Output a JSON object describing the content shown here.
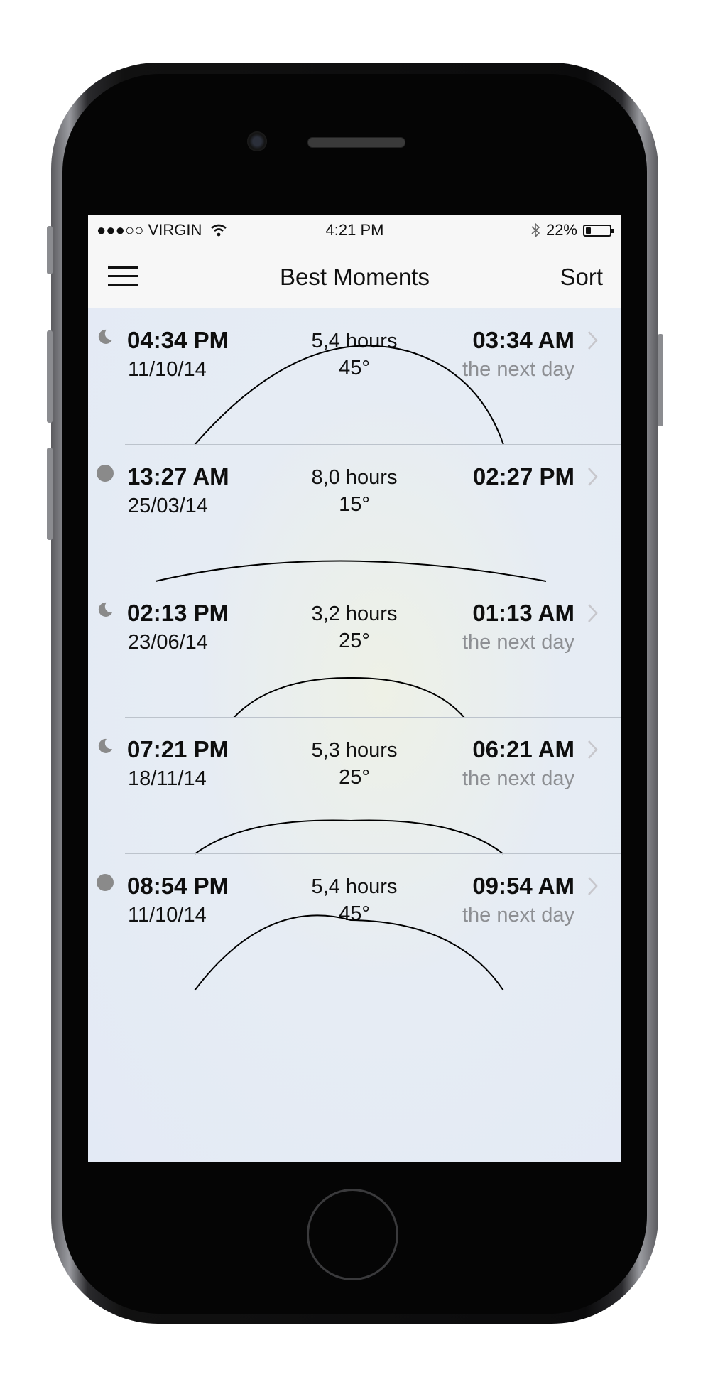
{
  "status_bar": {
    "carrier": "●●●○○ VIRGIN",
    "time": "4:21 PM",
    "battery_text": "22%",
    "battery_level": 0.22
  },
  "nav": {
    "title": "Best Moments",
    "sort_label": "Sort"
  },
  "colors": {
    "text": "#0e0e0e",
    "secondary_text": "#8d8f93",
    "indicator": "#8a8a8a",
    "divider": "#bcc3cc"
  },
  "moments": [
    {
      "icon": "moon-icon",
      "start_time": "04:34 PM",
      "date": "11/10/14",
      "duration": "5,4 hours",
      "angle": "45°",
      "end_time": "03:34 AM",
      "end_note": "the next day"
    },
    {
      "icon": "full-moon-icon",
      "start_time": "13:27 AM",
      "date": "25/03/14",
      "duration": "8,0 hours",
      "angle": "15°",
      "end_time": "02:27 PM",
      "end_note": ""
    },
    {
      "icon": "moon-icon",
      "start_time": "02:13 PM",
      "date": "23/06/14",
      "duration": "3,2 hours",
      "angle": "25°",
      "end_time": "01:13 AM",
      "end_note": "the next day"
    },
    {
      "icon": "moon-icon",
      "start_time": "07:21 PM",
      "date": "18/11/14",
      "duration": "5,3 hours",
      "angle": "25°",
      "end_time": "06:21 AM",
      "end_note": "the next day"
    },
    {
      "icon": "full-moon-icon",
      "start_time": "08:54 PM",
      "date": "11/10/14",
      "duration": "5,4 hours",
      "angle": "45°",
      "end_time": "09:54 AM",
      "end_note": "the next day"
    }
  ]
}
